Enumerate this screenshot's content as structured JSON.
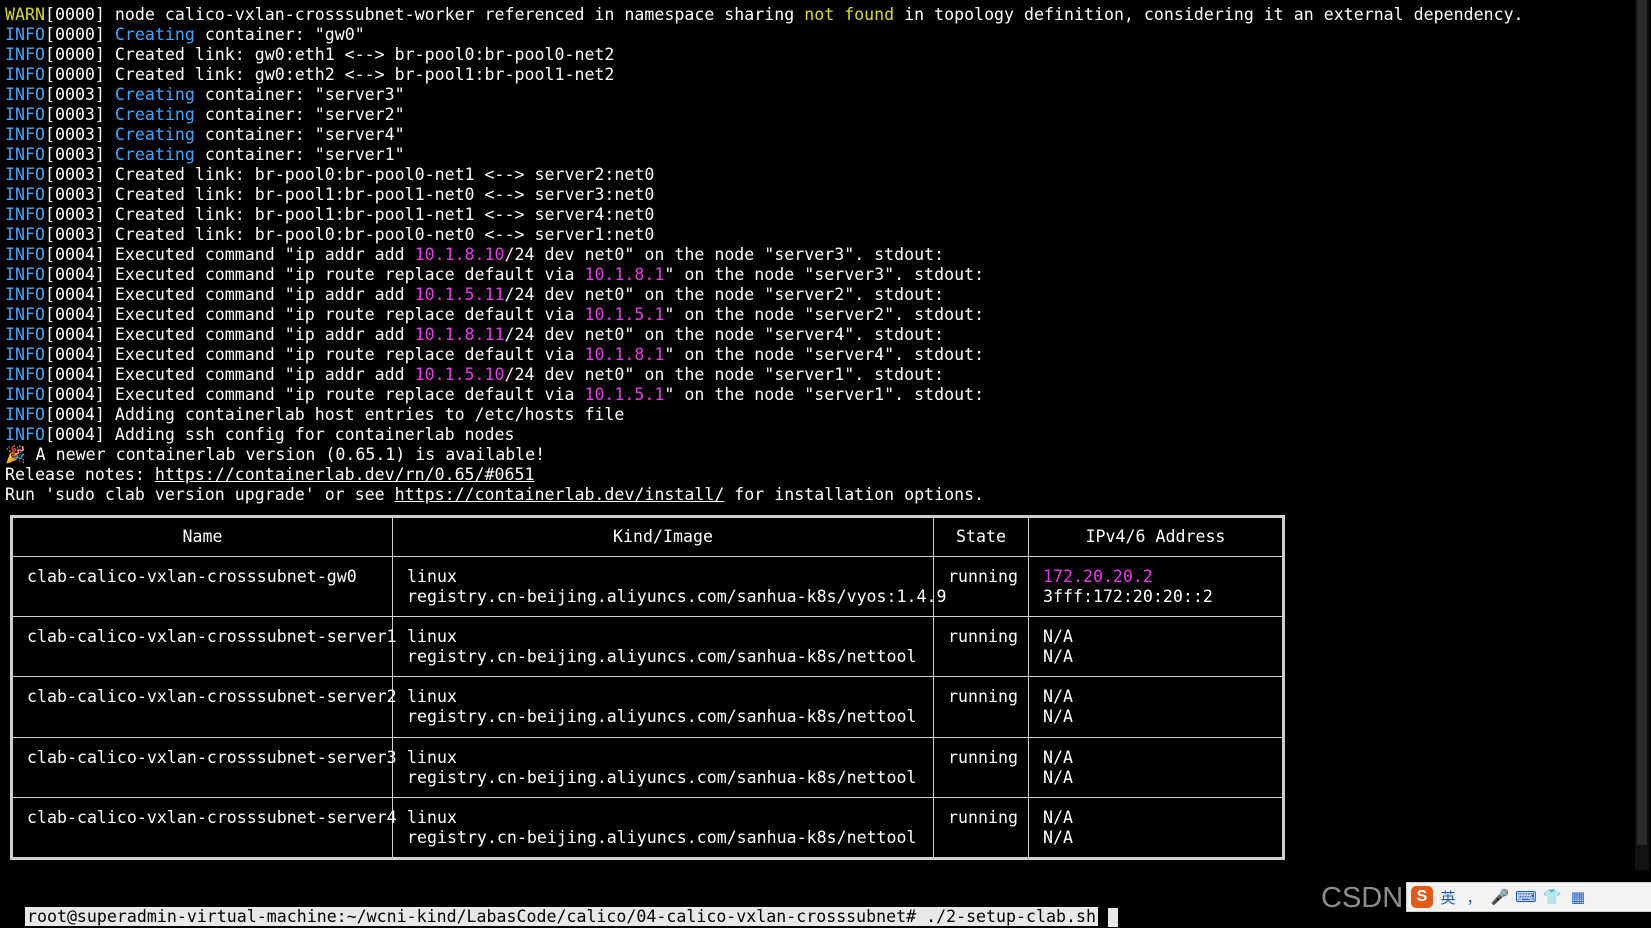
{
  "log": [
    {
      "parts": [
        {
          "t": "WARN",
          "c": "warn"
        },
        {
          "t": "[0000] node calico-vxlan-crosssubnet-worker referenced in namespace sharing "
        },
        {
          "t": "not found",
          "c": "hl"
        },
        {
          "t": " in topology definition, considering it an external dependency."
        }
      ]
    },
    {
      "parts": [
        {
          "t": "INFO",
          "c": "info"
        },
        {
          "t": "[0000] "
        },
        {
          "t": "Creating",
          "c": "cyan"
        },
        {
          "t": " container: \"gw0\""
        }
      ]
    },
    {
      "parts": [
        {
          "t": "INFO",
          "c": "info"
        },
        {
          "t": "[0000] Created link: gw0:eth1 <--> br-pool0:br-pool0-net2"
        }
      ]
    },
    {
      "parts": [
        {
          "t": "INFO",
          "c": "info"
        },
        {
          "t": "[0000] Created link: gw0:eth2 <--> br-pool1:br-pool1-net2"
        }
      ]
    },
    {
      "parts": [
        {
          "t": "INFO",
          "c": "info"
        },
        {
          "t": "[0003] "
        },
        {
          "t": "Creating",
          "c": "cyan"
        },
        {
          "t": " container: \"server3\""
        }
      ]
    },
    {
      "parts": [
        {
          "t": "INFO",
          "c": "info"
        },
        {
          "t": "[0003] "
        },
        {
          "t": "Creating",
          "c": "cyan"
        },
        {
          "t": " container: \"server2\""
        }
      ]
    },
    {
      "parts": [
        {
          "t": "INFO",
          "c": "info"
        },
        {
          "t": "[0003] "
        },
        {
          "t": "Creating",
          "c": "cyan"
        },
        {
          "t": " container: \"server4\""
        }
      ]
    },
    {
      "parts": [
        {
          "t": "INFO",
          "c": "info"
        },
        {
          "t": "[0003] "
        },
        {
          "t": "Creating",
          "c": "cyan"
        },
        {
          "t": " container: \"server1\""
        }
      ]
    },
    {
      "parts": [
        {
          "t": "INFO",
          "c": "info"
        },
        {
          "t": "[0003] Created link: br-pool0:br-pool0-net1 <--> server2:net0"
        }
      ]
    },
    {
      "parts": [
        {
          "t": "INFO",
          "c": "info"
        },
        {
          "t": "[0003] Created link: br-pool1:br-pool1-net0 <--> server3:net0"
        }
      ]
    },
    {
      "parts": [
        {
          "t": "INFO",
          "c": "info"
        },
        {
          "t": "[0003] Created link: br-pool1:br-pool1-net1 <--> server4:net0"
        }
      ]
    },
    {
      "parts": [
        {
          "t": "INFO",
          "c": "info"
        },
        {
          "t": "[0003] Created link: br-pool0:br-pool0-net0 <--> server1:net0"
        }
      ]
    },
    {
      "parts": [
        {
          "t": "INFO",
          "c": "info"
        },
        {
          "t": "[0004] Executed command \"ip addr add "
        },
        {
          "t": "10.1.8.10",
          "c": "mag"
        },
        {
          "t": "/24 dev net0\" on the node \"server3\". stdout:"
        }
      ]
    },
    {
      "parts": [
        {
          "t": "INFO",
          "c": "info"
        },
        {
          "t": "[0004] Executed command \"ip route replace default via "
        },
        {
          "t": "10.1.8.1",
          "c": "mag"
        },
        {
          "t": "\" on the node \"server3\". stdout:"
        }
      ]
    },
    {
      "parts": [
        {
          "t": "INFO",
          "c": "info"
        },
        {
          "t": "[0004] Executed command \"ip addr add "
        },
        {
          "t": "10.1.5.11",
          "c": "mag"
        },
        {
          "t": "/24 dev net0\" on the node \"server2\". stdout:"
        }
      ]
    },
    {
      "parts": [
        {
          "t": "INFO",
          "c": "info"
        },
        {
          "t": "[0004] Executed command \"ip route replace default via "
        },
        {
          "t": "10.1.5.1",
          "c": "mag"
        },
        {
          "t": "\" on the node \"server2\". stdout:"
        }
      ]
    },
    {
      "parts": [
        {
          "t": "INFO",
          "c": "info"
        },
        {
          "t": "[0004] Executed command \"ip addr add "
        },
        {
          "t": "10.1.8.11",
          "c": "mag"
        },
        {
          "t": "/24 dev net0\" on the node \"server4\". stdout:"
        }
      ]
    },
    {
      "parts": [
        {
          "t": "INFO",
          "c": "info"
        },
        {
          "t": "[0004] Executed command \"ip route replace default via "
        },
        {
          "t": "10.1.8.1",
          "c": "mag"
        },
        {
          "t": "\" on the node \"server4\". stdout:"
        }
      ]
    },
    {
      "parts": [
        {
          "t": "INFO",
          "c": "info"
        },
        {
          "t": "[0004] Executed command \"ip addr add "
        },
        {
          "t": "10.1.5.10",
          "c": "mag"
        },
        {
          "t": "/24 dev net0\" on the node \"server1\". stdout:"
        }
      ]
    },
    {
      "parts": [
        {
          "t": "INFO",
          "c": "info"
        },
        {
          "t": "[0004] Executed command \"ip route replace default via "
        },
        {
          "t": "10.1.5.1",
          "c": "mag"
        },
        {
          "t": "\" on the node \"server1\". stdout:"
        }
      ]
    },
    {
      "parts": [
        {
          "t": "INFO",
          "c": "info"
        },
        {
          "t": "[0004] Adding containerlab host entries to /etc/hosts file"
        }
      ]
    },
    {
      "parts": [
        {
          "t": "INFO",
          "c": "info"
        },
        {
          "t": "[0004] Adding ssh config for containerlab nodes"
        }
      ]
    },
    {
      "parts": [
        {
          "t": "🎉 A newer containerlab version (0.65.1) is available!"
        }
      ]
    },
    {
      "parts": [
        {
          "t": "Release notes: "
        },
        {
          "t": "https://containerlab.dev/rn/0.65/#0651",
          "c": "link"
        }
      ]
    },
    {
      "parts": [
        {
          "t": "Run 'sudo clab version upgrade' or see "
        },
        {
          "t": "https://containerlab.dev/install/",
          "c": "link"
        },
        {
          "t": " for installation options."
        }
      ]
    }
  ],
  "table": {
    "headers": [
      "Name",
      "Kind/Image",
      "State",
      "IPv4/6 Address"
    ],
    "rows": [
      {
        "name": "clab-calico-vxlan-crosssubnet-gw0",
        "kind": "linux",
        "image": "registry.cn-beijing.aliyuncs.com/sanhua-k8s/vyos:1.4.9",
        "state": "running",
        "ipv4": "172.20.20.2",
        "ipv6": "3fff:172:20:20::2"
      },
      {
        "name": "clab-calico-vxlan-crosssubnet-server1",
        "kind": "linux",
        "image": "registry.cn-beijing.aliyuncs.com/sanhua-k8s/nettool",
        "state": "running",
        "ipv4": "N/A",
        "ipv6": "N/A"
      },
      {
        "name": "clab-calico-vxlan-crosssubnet-server2",
        "kind": "linux",
        "image": "registry.cn-beijing.aliyuncs.com/sanhua-k8s/nettool",
        "state": "running",
        "ipv4": "N/A",
        "ipv6": "N/A"
      },
      {
        "name": "clab-calico-vxlan-crosssubnet-server3",
        "kind": "linux",
        "image": "registry.cn-beijing.aliyuncs.com/sanhua-k8s/nettool",
        "state": "running",
        "ipv4": "N/A",
        "ipv6": "N/A"
      },
      {
        "name": "clab-calico-vxlan-crosssubnet-server4",
        "kind": "linux",
        "image": "registry.cn-beijing.aliyuncs.com/sanhua-k8s/nettool",
        "state": "running",
        "ipv4": "N/A",
        "ipv6": "N/A"
      }
    ]
  },
  "prompt": {
    "text": "root@superadmin-virtual-machine:~/wcni-kind/LabasCode/calico/04-calico-vxlan-crosssubnet# ./2-setup-clab.sh"
  },
  "watermark": {
    "text": "CSDN @圣圣不爱学习",
    "ime_logo": "S",
    "ime_items": [
      "英",
      "，",
      "🎤",
      "⌨",
      "👕",
      "▦"
    ]
  },
  "colors": {
    "background": "#000000",
    "warn": "#d8d82a",
    "info": "#3fa7ff",
    "ip_highlight": "#e83be8",
    "text": "#ffffff"
  }
}
